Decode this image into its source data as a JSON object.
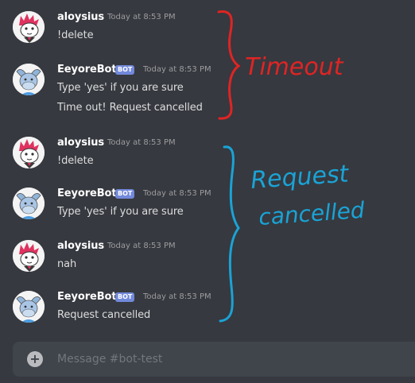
{
  "messages": [
    {
      "author": "aloysius",
      "timestamp": "Today at 8:53 PM",
      "lines": [
        "!delete"
      ]
    },
    {
      "author": "EeyoreBot",
      "badge": "BOT",
      "timestamp": "Today at 8:53 PM",
      "lines": [
        "Type 'yes' if you are sure",
        "Time out! Request cancelled"
      ]
    },
    {
      "author": "aloysius",
      "timestamp": "Today at 8:53 PM",
      "lines": [
        "!delete"
      ]
    },
    {
      "author": "EeyoreBot",
      "badge": "BOT",
      "timestamp": "Today at 8:53 PM",
      "lines": [
        "Type 'yes' if you are sure"
      ]
    },
    {
      "author": "aloysius",
      "timestamp": "Today at 8:53 PM",
      "lines": [
        "nah"
      ]
    },
    {
      "author": "EeyoreBot",
      "badge": "BOT",
      "timestamp": "Today at 8:53 PM",
      "lines": [
        "Request cancelled"
      ]
    }
  ],
  "annotations": {
    "timeout": {
      "label": "Timeout",
      "color": "#e02424"
    },
    "request_cancelled": {
      "line1": "Request",
      "line2": "cancelled",
      "color": "#1aa3d6"
    }
  },
  "composer": {
    "placeholder": "Message #bot-test",
    "add_icon": "plus-circle-icon"
  },
  "colors": {
    "background": "#36393f",
    "composer": "#40444b",
    "bot_badge": "#7289da",
    "username": "#ffffff",
    "text": "#dcddde",
    "timestamp": "#9b9c9f"
  }
}
